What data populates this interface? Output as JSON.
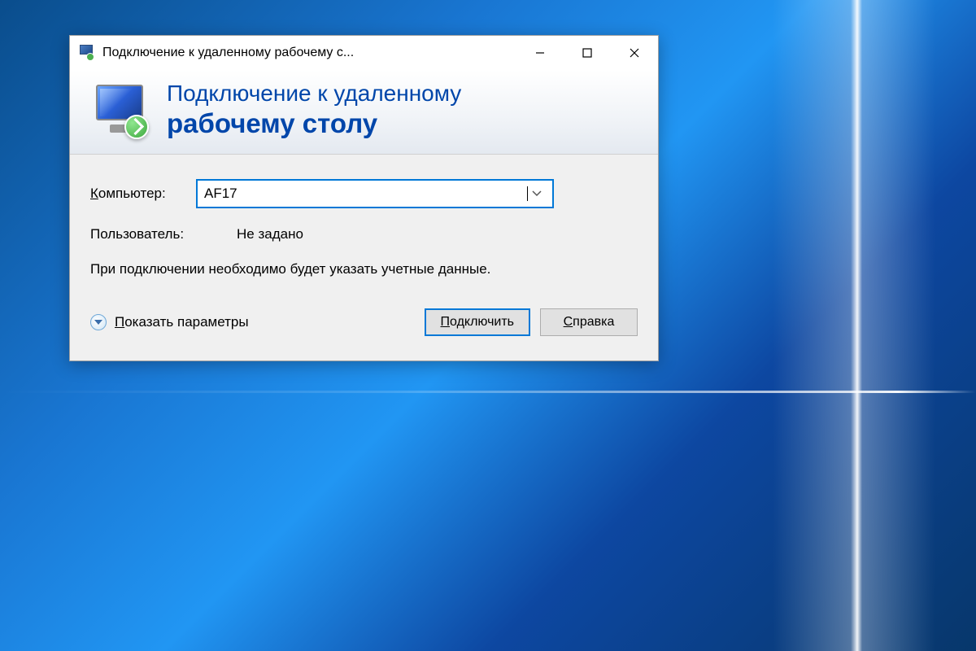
{
  "window": {
    "title": "Подключение к удаленному рабочему с..."
  },
  "header": {
    "line1": "Подключение к удаленному",
    "line2": "рабочему столу"
  },
  "form": {
    "computer_label_prefix": "К",
    "computer_label_rest": "омпьютер:",
    "computer_value": "AF17",
    "user_label": "Пользователь:",
    "user_value": "Не задано",
    "info_text": "При подключении необходимо будет указать учетные данные."
  },
  "footer": {
    "show_options_prefix": "П",
    "show_options_rest": "оказать параметры",
    "connect_prefix": "П",
    "connect_rest": "одключить",
    "help_prefix": "С",
    "help_rest": "правка"
  }
}
